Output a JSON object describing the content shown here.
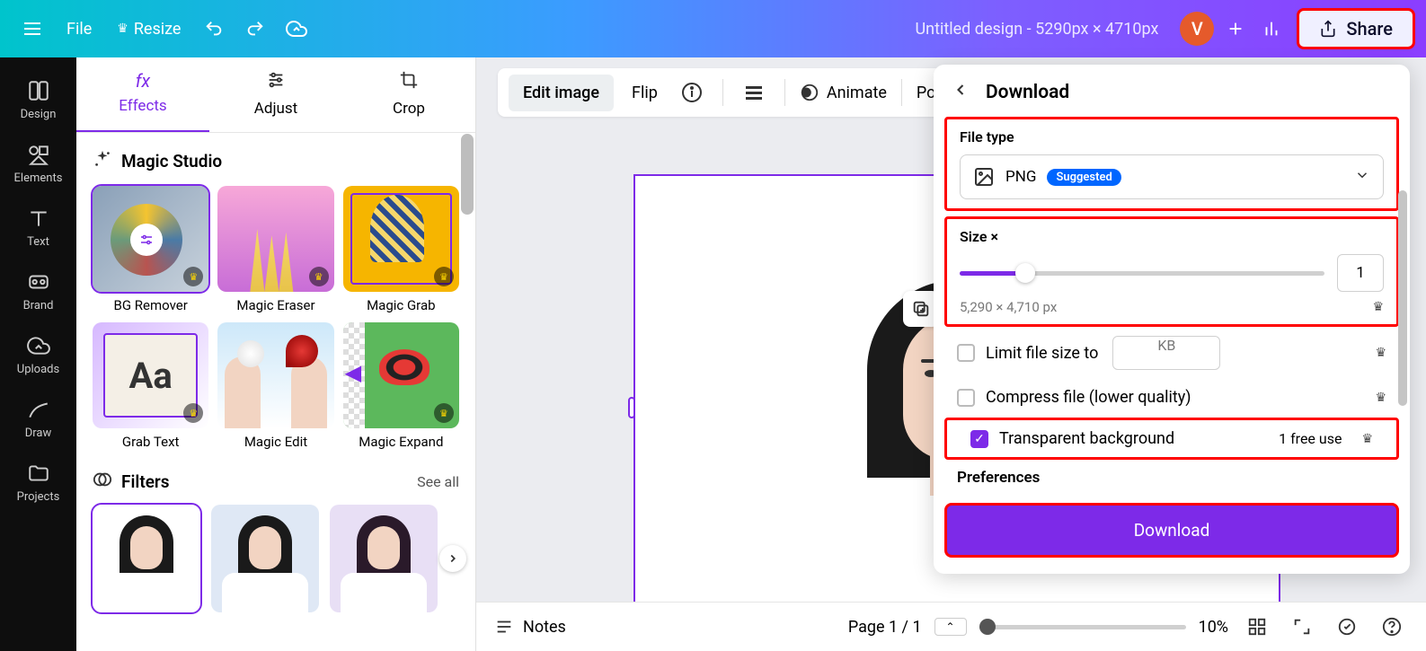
{
  "header": {
    "file": "File",
    "resize": "Resize",
    "title": "Untitled design - 5290px × 4710px",
    "avatar_letter": "V",
    "share": "Share"
  },
  "rail": [
    {
      "label": "Design",
      "icon": "design"
    },
    {
      "label": "Elements",
      "icon": "elements"
    },
    {
      "label": "Text",
      "icon": "text"
    },
    {
      "label": "Brand",
      "icon": "brand"
    },
    {
      "label": "Uploads",
      "icon": "uploads"
    },
    {
      "label": "Draw",
      "icon": "draw"
    },
    {
      "label": "Projects",
      "icon": "projects"
    }
  ],
  "side": {
    "tabs": [
      {
        "label": "Effects",
        "active": true
      },
      {
        "label": "Adjust",
        "active": false
      },
      {
        "label": "Crop",
        "active": false
      }
    ],
    "magic_title": "Magic Studio",
    "tools": [
      {
        "label": "BG Remover",
        "bg": "linear-gradient(135deg,#8aa0b8,#c8d2dc)",
        "crown": true,
        "selected": true
      },
      {
        "label": "Magic Eraser",
        "bg": "linear-gradient(#f7a8d8,#f06292)",
        "crown": true
      },
      {
        "label": "Magic Grab",
        "bg": "#f6b500",
        "crown": true
      },
      {
        "label": "Grab Text",
        "bg": "linear-gradient(135deg,#a87cff,#fff)",
        "crown": true
      },
      {
        "label": "Magic Edit",
        "bg": "linear-gradient(#fff,#d0f0ff)",
        "crown": false
      },
      {
        "label": "Magic Expand",
        "bg": "#4caf50",
        "crown": true
      }
    ],
    "filters_title": "Filters",
    "see_all": "See all",
    "filters": [
      {
        "bg": "#ffffff",
        "selected": true
      },
      {
        "bg": "#dfe8f5"
      },
      {
        "bg": "#e8dff5"
      }
    ]
  },
  "ctx": {
    "edit_image": "Edit image",
    "flip": "Flip",
    "animate": "Animate",
    "position": "Po"
  },
  "download": {
    "title": "Download",
    "file_type_label": "File type",
    "file_type": "PNG",
    "suggested": "Suggested",
    "size_label": "Size ×",
    "size_value": "1",
    "dims": "5,290 × 4,710 px",
    "limit_label": "Limit file size to",
    "kb": "KB",
    "compress_label": "Compress file (lower quality)",
    "transparent_label": "Transparent background",
    "free_use": "1 free use",
    "prefs": "Preferences",
    "button": "Download"
  },
  "bottom": {
    "notes": "Notes",
    "page": "Page 1 / 1",
    "zoom": "10%"
  }
}
